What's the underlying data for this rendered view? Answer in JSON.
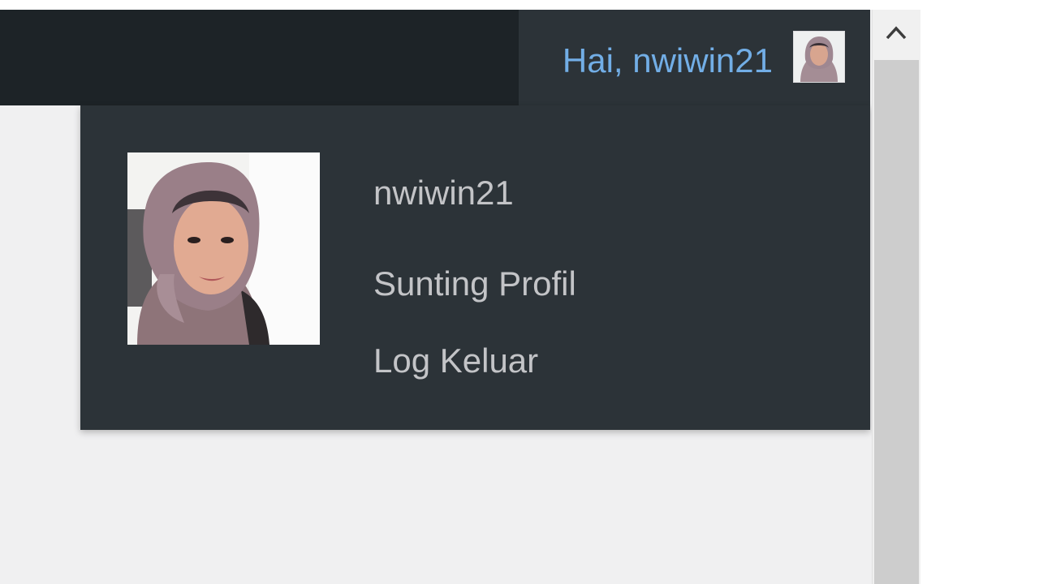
{
  "admin_bar": {
    "greeting": "Hai, nwiwin21",
    "avatar_icon": "user-avatar"
  },
  "account_menu": {
    "username": "nwiwin21",
    "edit_profile": "Sunting Profil",
    "log_out": "Log Keluar"
  },
  "scrollbar": {
    "up_icon": "chevron-up-icon"
  },
  "colors": {
    "admin_bar_bg": "#1d2327",
    "menu_bg": "#2c3338",
    "greeting_link": "#72aee6",
    "menu_text": "#c3c4c7",
    "page_bg": "#f0f0f1"
  }
}
